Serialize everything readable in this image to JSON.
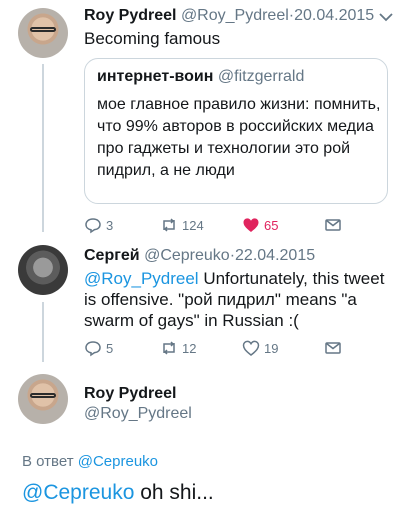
{
  "colors": {
    "accent": "#1b95e0",
    "like": "#e0245e",
    "muted": "#657786",
    "border": "#ccd6dd"
  },
  "tweet1": {
    "name": "Roy Pydreel",
    "handle": "@Roy_Pydreel",
    "dot": "·",
    "date": "20.04.2015",
    "text": "Becoming famous",
    "quote": {
      "name": "интернет-воин",
      "handle": "@fitzgerrald",
      "text": "мое главное правило жизни: помнить, что 99% авторов в российских медиа про гаджеты и технологии это рой пидрил, а не люди"
    },
    "actions": {
      "replies": "3",
      "retweets": "124",
      "likes": "65"
    }
  },
  "tweet2": {
    "name": "Сергей",
    "handle": "@Cepreuko",
    "dot": "·",
    "date": "22.04.2015",
    "mention": "@Roy_Pydreel",
    "text": " Unfortunately, this tweet is offensive. \"рой пидрил\" means \"a swarm of gays\" in Russian :(",
    "actions": {
      "replies": "5",
      "retweets": "12",
      "likes": "19"
    }
  },
  "main_tweet": {
    "name": "Roy Pydreel",
    "handle": "@Roy_Pydreel",
    "reply_prefix": "В ответ ",
    "reply_to": "@Cepreuko",
    "mention": "@Cepreuko",
    "text": " oh shi..."
  }
}
